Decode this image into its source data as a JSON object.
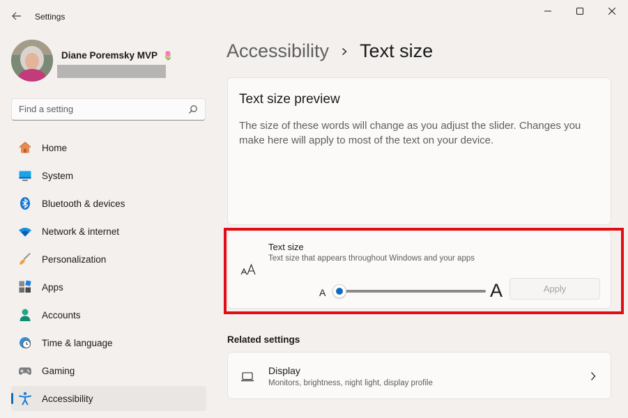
{
  "window": {
    "title": "Settings"
  },
  "user": {
    "name": "Diane Poremsky MVP",
    "badge": "🌷"
  },
  "search": {
    "placeholder": "Find a setting"
  },
  "nav": {
    "items": [
      {
        "label": "Home",
        "icon": "home-icon"
      },
      {
        "label": "System",
        "icon": "system-monitor-icon"
      },
      {
        "label": "Bluetooth & devices",
        "icon": "bluetooth-icon"
      },
      {
        "label": "Network & internet",
        "icon": "wifi-icon"
      },
      {
        "label": "Personalization",
        "icon": "paintbrush-icon"
      },
      {
        "label": "Apps",
        "icon": "apps-icon"
      },
      {
        "label": "Accounts",
        "icon": "person-icon"
      },
      {
        "label": "Time & language",
        "icon": "clock-globe-icon"
      },
      {
        "label": "Gaming",
        "icon": "gamepad-icon"
      },
      {
        "label": "Accessibility",
        "icon": "accessibility-icon"
      }
    ],
    "active_index": 9
  },
  "breadcrumb": {
    "parent": "Accessibility",
    "current": "Text size"
  },
  "preview": {
    "title": "Text size preview",
    "body": "The size of these words will change as you adjust the slider. Changes you make here will apply to most of the text on your device."
  },
  "text_size": {
    "title": "Text size",
    "description": "Text size that appears throughout Windows and your apps",
    "slider_min_label": "A",
    "slider_max_label": "A",
    "slider_value_percent": 0,
    "apply_label": "Apply"
  },
  "related": {
    "heading": "Related settings",
    "display": {
      "title": "Display",
      "description": "Monitors, brightness, night light, display profile"
    }
  },
  "colors": {
    "accent": "#0f6cbd",
    "highlight": "#e00c16"
  }
}
